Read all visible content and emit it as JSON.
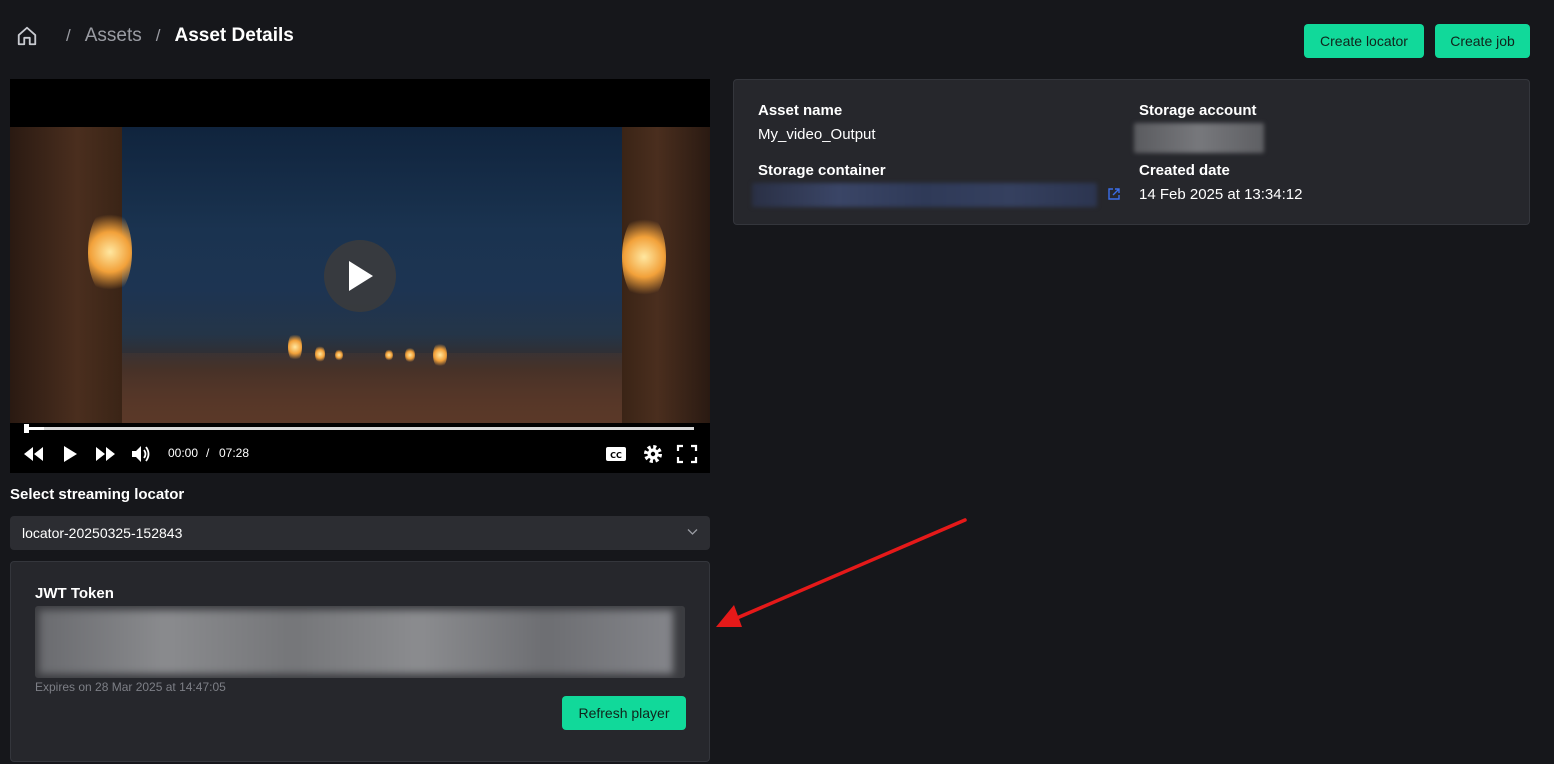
{
  "breadcrumb": {
    "home_icon": "home-icon",
    "items": [
      "Assets",
      "Asset Details"
    ],
    "separator": "/"
  },
  "header_actions": {
    "create_locator": "Create locator",
    "create_job": "Create job"
  },
  "player": {
    "current_time": "00:00",
    "time_separator": "/",
    "duration": "07:28",
    "progress": 0.0,
    "icons": [
      "rewind-icon",
      "play-icon",
      "fast-forward-icon",
      "volume-icon",
      "closed-captions-icon",
      "settings-gear-icon",
      "fullscreen-icon"
    ]
  },
  "asset_info": {
    "asset_name_label": "Asset name",
    "asset_name_value": "My_video_Output",
    "storage_account_label": "Storage account",
    "storage_container_label": "Storage container",
    "created_date_label": "Created date",
    "created_date_value": "14 Feb 2025 at 13:34:12"
  },
  "locator_select": {
    "label": "Select streaming locator",
    "selected": "locator-20250325-152843"
  },
  "jwt": {
    "label": "JWT Token",
    "expires": "Expires on 28 Mar 2025 at 14:47:05",
    "refresh_button": "Refresh player"
  },
  "colors": {
    "background": "#16171b",
    "card": "#26272c",
    "accent_green": "#11d99a",
    "annotation_red": "#e51919",
    "link_blue": "#3b6ee8"
  }
}
